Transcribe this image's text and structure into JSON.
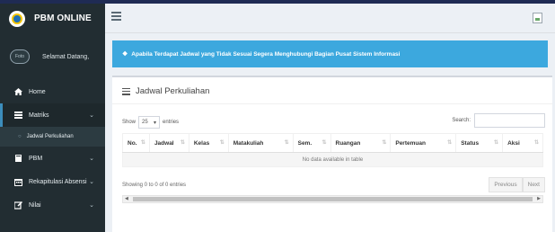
{
  "brand": {
    "title": "PBM ONLINE"
  },
  "user": {
    "avatar_alt": "Foto",
    "greeting": "Selamat Datang,"
  },
  "sidebar": {
    "items": [
      {
        "label": "Home",
        "icon": "home-icon"
      },
      {
        "label": "Matriks",
        "icon": "list-icon"
      },
      {
        "label": "Jadwal Perkuliahan",
        "icon": "circle-icon"
      },
      {
        "label": "PBM",
        "icon": "book-icon"
      },
      {
        "label": "Rekapitulasi Absensi",
        "icon": "calendar-icon"
      },
      {
        "label": "Nilai",
        "icon": "edit-icon"
      }
    ]
  },
  "alert": {
    "message": "Apabila Terdapat Jadwal yang Tidak Sesuai Segera Menghubungi Bagian Pusat Sistem Informasi"
  },
  "box": {
    "title": "Jadwal Perkuliahan"
  },
  "table": {
    "show_label": "Show",
    "length_value": "25",
    "entries_label": "entries",
    "search_label": "Search:",
    "search_value": "",
    "columns": [
      "No.",
      "Jadwal",
      "Kelas",
      "Matakuliah",
      "Sem.",
      "Ruangan",
      "Pertemuan",
      "Status",
      "Aksi"
    ],
    "empty_text": "No data available in table",
    "info": "Showing 0 to 0 of 0 entries",
    "previous_label": "Previous",
    "next_label": "Next"
  },
  "colors": {
    "sidebar": "#222d32",
    "alert": "#3ca8de",
    "active_border": "#3c8dbc",
    "content_bg": "#ecf0f5"
  }
}
